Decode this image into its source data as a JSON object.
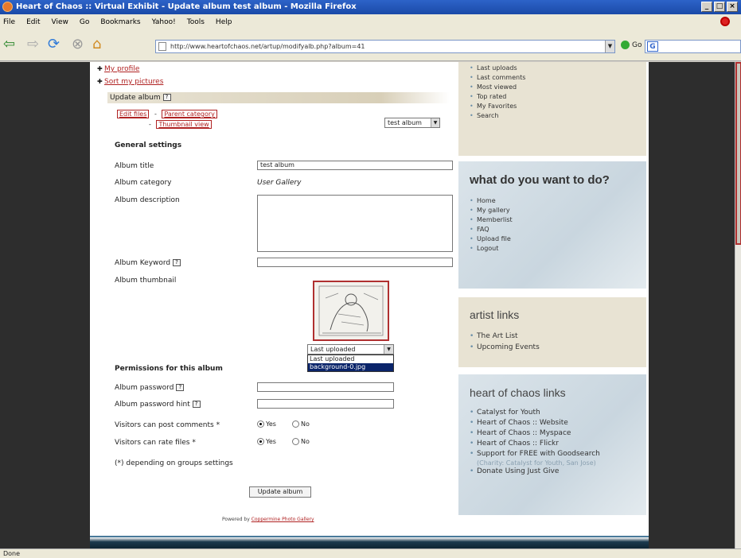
{
  "window": {
    "title": "Heart of Chaos :: Virtual Exhibit - Update album test album - Mozilla Firefox"
  },
  "menu": [
    "File",
    "Edit",
    "View",
    "Go",
    "Bookmarks",
    "Yahoo!",
    "Tools",
    "Help"
  ],
  "nav": {
    "url": "http://www.heartofchaos.net/artup/modifyalb.php?album=41",
    "go_label": "Go",
    "search_placeholder": ""
  },
  "top_links": [
    "My profile",
    "Sort my pictures"
  ],
  "update_header": "Update album",
  "tabs": {
    "edit_files": "Edit files",
    "parent_category": "Parent category",
    "thumbnail_view": "Thumbnail view",
    "separator": "-"
  },
  "album_select": "test album",
  "form": {
    "general_settings": "General settings",
    "album_title_label": "Album title",
    "album_title_value": "test album",
    "album_category_label": "Album category",
    "album_category_value": "User Gallery",
    "album_description_label": "Album description",
    "album_keyword_label": "Album Keyword",
    "album_thumbnail_label": "Album thumbnail",
    "thumbnail_select": "Last uploaded",
    "thumbnail_options": [
      "Last uploaded",
      "background-0.jpg"
    ],
    "permissions_label": "Permissions for this album",
    "album_password_label": "Album password",
    "album_password_hint_label": "Album password hint",
    "comments_label": "Visitors can post comments *",
    "rate_label": "Visitors can rate files *",
    "yes": "Yes",
    "no": "No",
    "footnote": "(*) depending on groups settings",
    "update_button": "Update album"
  },
  "powered": {
    "prefix": "Powered by",
    "link": "Coppermine Photo Gallery"
  },
  "right_panels": {
    "top_list": [
      "Last uploads",
      "Last comments",
      "Most viewed",
      "Top rated",
      "My Favorites",
      "Search"
    ],
    "what_title": "what do you want to do?",
    "what_list": [
      "Home",
      "My gallery",
      "Memberlist",
      "FAQ",
      "Upload file",
      "Logout"
    ],
    "artist_title": "artist links",
    "artist_list": [
      "The Art List",
      "Upcoming Events"
    ],
    "hoc_title": "heart of chaos links",
    "hoc_list": [
      "Catalyst for Youth",
      "Heart of Chaos :: Website",
      "Heart of Chaos :: Myspace",
      "Heart of Chaos :: Flickr",
      "Support for FREE with Goodsearch",
      "Donate Using Just Give"
    ],
    "hoc_note": "(Charity: Catalyst for Youth, San Jose)"
  },
  "status": "Done"
}
